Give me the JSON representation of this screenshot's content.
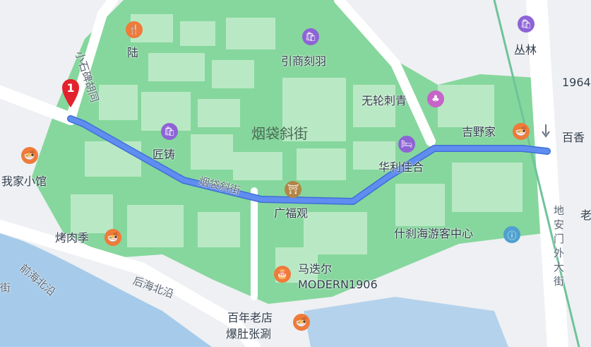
{
  "colors": {
    "park": "#86d79d",
    "block": "#b9e9c4",
    "water": "#a6cbea",
    "route": "#5f8df0",
    "marker": "#e2232d"
  },
  "route": {
    "start_number": "1"
  },
  "labels": {
    "xiaoshibei": "小石碑胡同",
    "lu": "陆",
    "yinshang": "引商刻羽",
    "conglin": "丛林",
    "n1964": "1964",
    "wulun": "无轮刺青",
    "yandai": "烟袋斜街",
    "yandai_road": "烟袋斜街",
    "jiangzhu": "匠铸",
    "jiyejia": "吉野家",
    "baixiang": "百香",
    "huali": "华利佳合",
    "wojia": "我家小馆",
    "guangfu": "广福观",
    "kaorouji": "烤肉季",
    "shichahai": "什刹海游客中心",
    "dianmen": "地安门外大街",
    "lao": "老",
    "qianhai": "前海北沿",
    "houhai": "后海北沿",
    "madie": "马迭尔",
    "modern": "MODERN1906",
    "bainian": "百年老店",
    "baodu": "爆肚张涮",
    "jie": "街"
  },
  "pois": {
    "lu": "restaurant-icon",
    "yinshang": "shopping-icon",
    "conglin": "shopping-icon",
    "wulun": "tattoo-icon",
    "jiangzhu": "shopping-icon",
    "jiyejia": "restaurant-icon",
    "huali": "hotel-icon",
    "wojia": "restaurant-icon",
    "guangfu": "temple-icon",
    "kaorouji": "restaurant-icon",
    "shichahai": "visitor-center-icon",
    "madie": "restaurant-icon",
    "bainian": "restaurant-icon"
  }
}
